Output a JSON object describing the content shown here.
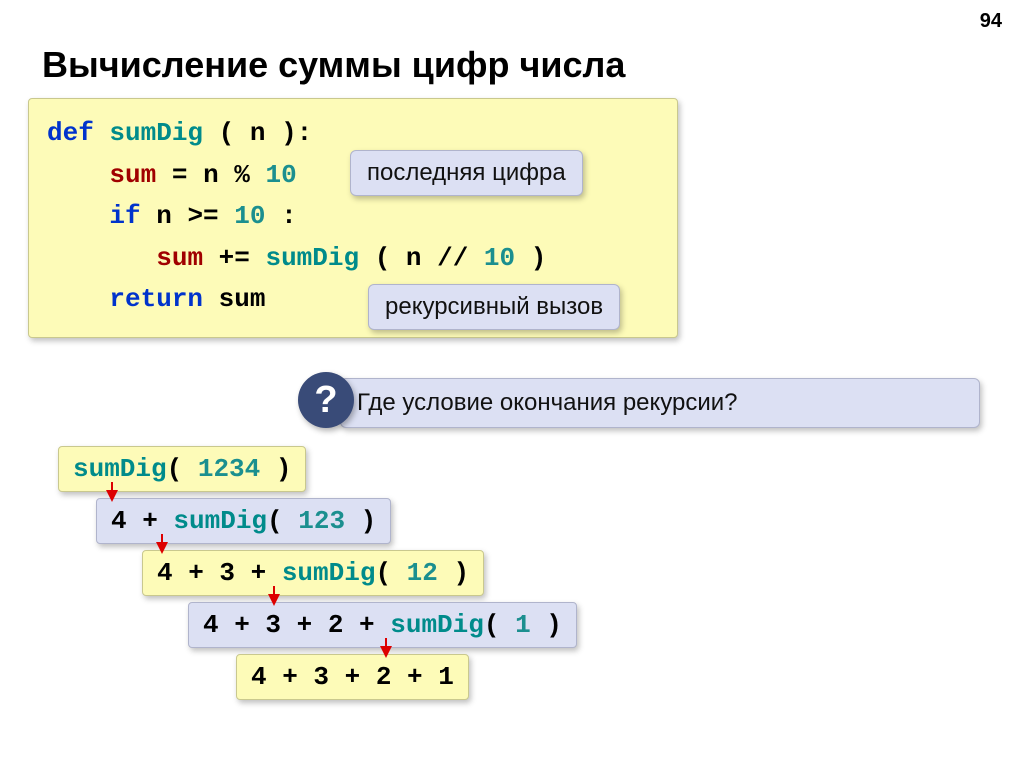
{
  "pageNumber": "94",
  "title": "Вычисление суммы цифр числа",
  "code": {
    "l1_def": "def",
    "l1_fn": "sumDig",
    "l1_paren": " ( n ):",
    "l2_sum": "sum",
    "l2_eq": " = ",
    "l2_n": "n % ",
    "l2_ten": "10",
    "l3_if": "if",
    "l3_cond": " n >= ",
    "l3_ten": "10",
    "l3_colon": ":",
    "l4_sum": "sum",
    "l4_pe": " += ",
    "l4_fn": "sumDig",
    "l4_arg1": " ( n // ",
    "l4_ten": "10",
    "l4_arg2": " )",
    "l5_ret": "return",
    "l5_sum": " sum"
  },
  "callouts": {
    "lastDigit": "последняя цифра",
    "recursiveCall": "рекурсивный вызов"
  },
  "questionMark": "?",
  "questionText": "Где условие окончания рекурсии?",
  "steps": {
    "s0_fn": "sumDig",
    "s0_op": "( ",
    "s0_num": "1234",
    "s0_cl": " )",
    "s1_pre": "4 + ",
    "s1_fn": "sumDig",
    "s1_op": "( ",
    "s1_num": "123",
    "s1_cl": " )",
    "s2_pre": "4 + 3 + ",
    "s2_fn": "sumDig",
    "s2_op": "( ",
    "s2_num": "12",
    "s2_cl": " )",
    "s3_pre": "4 + 3 + 2 + ",
    "s3_fn": "sumDig",
    "s3_op": "( ",
    "s3_num": "1",
    "s3_cl": " )",
    "s4": "4 + 3 + 2 + 1"
  }
}
